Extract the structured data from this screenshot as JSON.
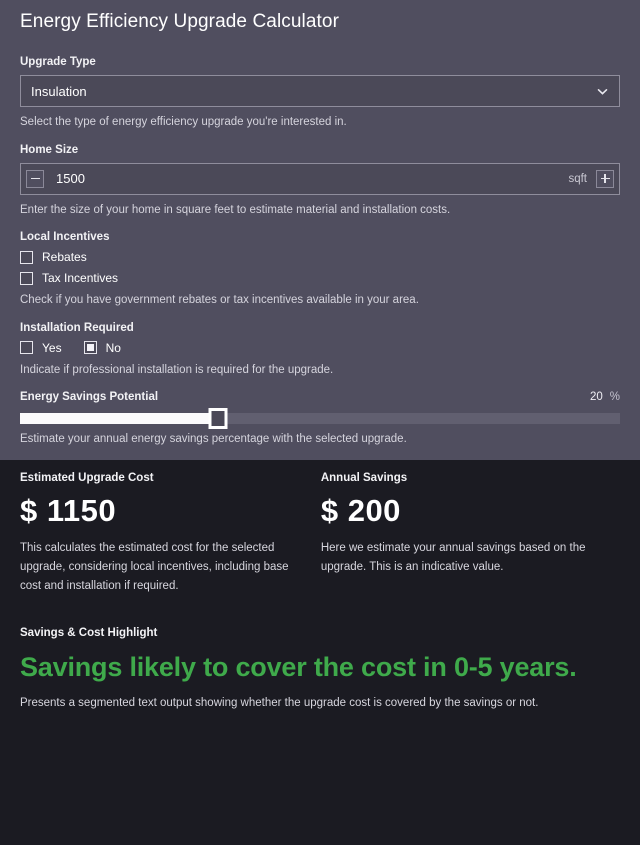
{
  "header": {
    "title": "Energy Efficiency Upgrade Calculator"
  },
  "upgrade_type": {
    "label": "Upgrade Type",
    "selected": "Insulation",
    "options": [
      "Insulation"
    ],
    "chevron_icon": "chevron-down-icon",
    "help": "Select the type of energy efficiency upgrade you're interested in."
  },
  "home_size": {
    "label": "Home Size",
    "value": "1500",
    "unit": "sqft",
    "decrement_icon": "minus-icon",
    "increment_icon": "plus-icon",
    "help": "Enter the size of your home in square feet to estimate material and installation costs."
  },
  "local_incentives": {
    "label": "Local Incentives",
    "options": [
      {
        "label": "Rebates",
        "checked": false
      },
      {
        "label": "Tax Incentives",
        "checked": false
      }
    ],
    "help": "Check if you have government rebates or tax incentives available in your area."
  },
  "installation_required": {
    "label": "Installation Required",
    "options": [
      {
        "label": "Yes",
        "checked": false
      },
      {
        "label": "No",
        "checked": true
      }
    ],
    "help": "Indicate if professional installation is required for the upgrade."
  },
  "energy_savings": {
    "label": "Energy Savings Potential",
    "value": "20",
    "unit": "%",
    "percent_filled": 33,
    "min": 0,
    "max": 60,
    "help": "Estimate your annual energy savings percentage with the selected upgrade."
  },
  "results": {
    "metrics": [
      {
        "label": "Estimated Upgrade Cost",
        "value": "$ 1150",
        "description": "This calculates the estimated cost for the selected upgrade, considering local incentives, including base cost and installation if required."
      },
      {
        "label": "Annual Savings",
        "value": "$ 200",
        "description": "Here we estimate your annual savings based on the upgrade. This is an indicative value."
      }
    ],
    "highlight": {
      "label": "Savings & Cost Highlight",
      "text": "Savings likely to cover the cost in 0-5 years.",
      "color": "#3faa4b",
      "description": "Presents a segmented text output showing whether the upgrade cost is covered by the savings or not."
    }
  }
}
